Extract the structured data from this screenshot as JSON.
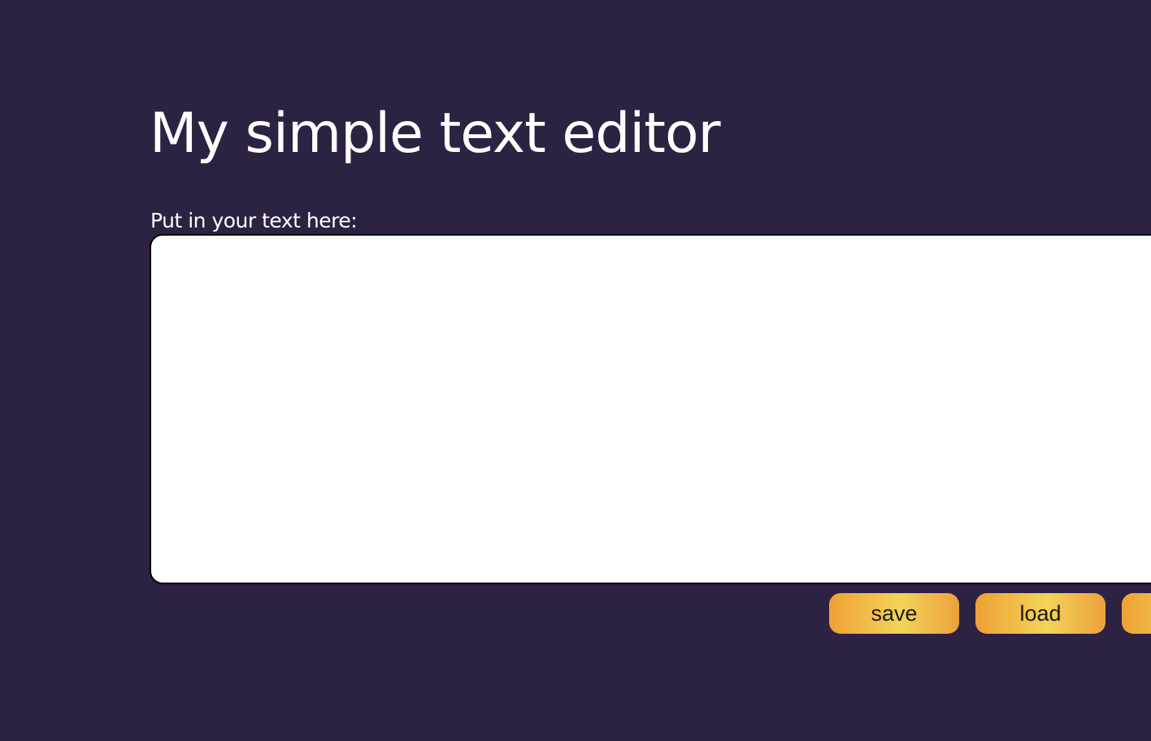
{
  "header": {
    "title": "My simple text editor"
  },
  "editor": {
    "label": "Put in your text here:",
    "value": ""
  },
  "toolbar": {
    "save_label": "save",
    "load_label": "load",
    "third_label": ""
  },
  "colors": {
    "background": "#2d2242",
    "button_gradient_start": "#f0a035",
    "button_gradient_mid": "#f2d45a",
    "text_light": "#ffffff"
  }
}
